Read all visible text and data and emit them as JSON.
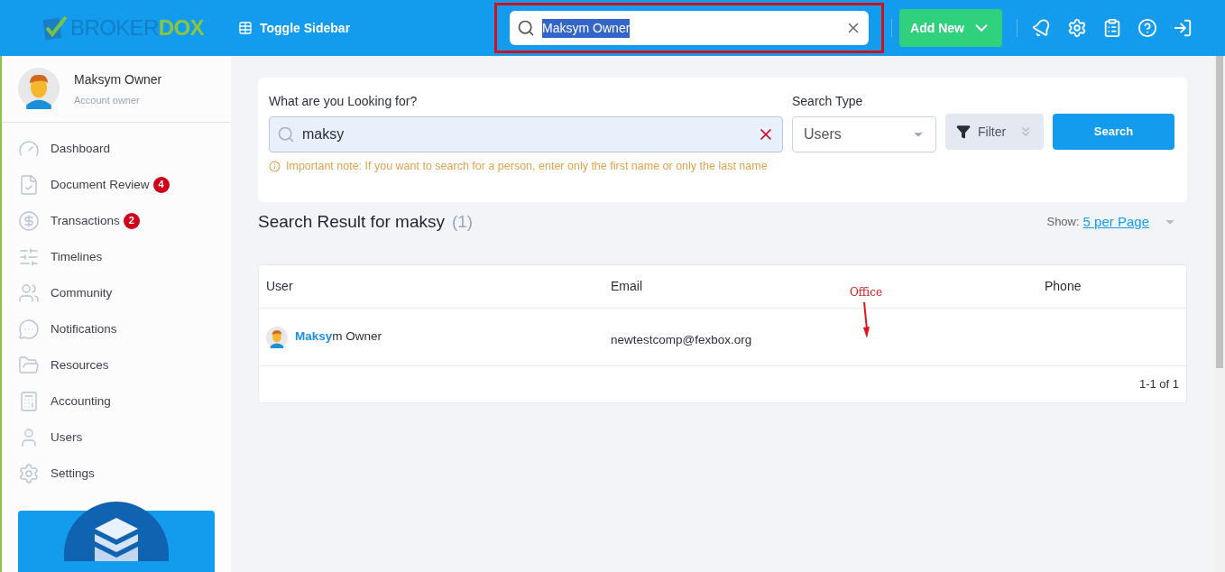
{
  "header": {
    "logo": {
      "part1": "BROKER",
      "part2": "DOX"
    },
    "toggle_sidebar": "Toggle Sidebar",
    "global_search": {
      "value": "Maksym Owner",
      "selected_text": true
    },
    "add_new": "Add New"
  },
  "profile": {
    "name": "Maksym Owner",
    "role": "Account owner"
  },
  "sidebar": {
    "items": [
      {
        "label": "Dashboard"
      },
      {
        "label": "Document Review",
        "badge": "4"
      },
      {
        "label": "Transactions",
        "badge": "2"
      },
      {
        "label": "Timelines"
      },
      {
        "label": "Community"
      },
      {
        "label": "Notifications"
      },
      {
        "label": "Resources"
      },
      {
        "label": "Accounting"
      },
      {
        "label": "Users"
      },
      {
        "label": "Settings"
      }
    ]
  },
  "search_panel": {
    "query_label": "What are you Looking for?",
    "query_value": "maksy",
    "type_label": "Search Type",
    "type_value": "Users",
    "filter": "Filter",
    "search_button": "Search",
    "note": "Important note: If you want to search for a person, enter only the first name or only the last name"
  },
  "results": {
    "title": "Search Result for maksy",
    "count": "(1)",
    "show_label": "Show:",
    "per_page": "5 per Page",
    "table": {
      "columns": [
        "User",
        "Email",
        "Phone"
      ],
      "rows": [
        {
          "user": "**Maksy**m Owner",
          "email": "newtestcomp@fexbox.org"
        }
      ],
      "pagination": "1-1 of 1"
    }
  },
  "annotation": {
    "text": "Office"
  }
}
